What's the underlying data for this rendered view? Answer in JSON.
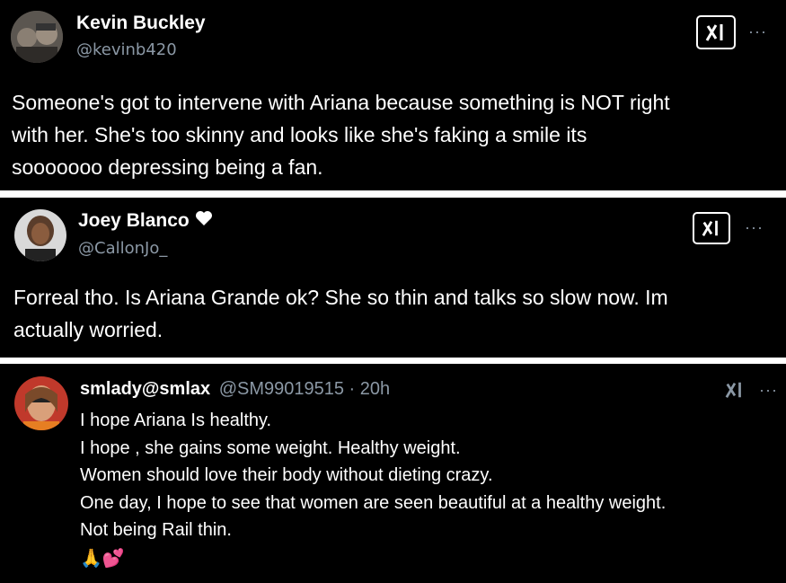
{
  "tweets": [
    {
      "name": "Kevin Buckley",
      "handle": "@kevinb420",
      "lines": [
        "Someone's got to intervene with Ariana because something is NOT right",
        "with her. She's too skinny and looks like she's faking a smile its",
        "sooooooo depressing being a fan."
      ]
    },
    {
      "name": "Joey Blanco",
      "handle": "@CallonJo_",
      "lines": [
        "Forreal tho. Is Ariana Grande ok? She so thin and talks so slow now. Im",
        "actually worried."
      ]
    },
    {
      "name": "smlady@smlax",
      "handle": "@SM99019515 · 20h",
      "lines": [
        "I hope Ariana Is healthy.",
        "I hope , she gains some weight. Healthy weight.",
        "Women should love their body without dieting crazy.",
        "One day, I hope to see that women are seen beautiful at a healthy weight.",
        "Not being Rail thin."
      ],
      "emoji": "🙏💕"
    }
  ],
  "more_label": "···",
  "colors": {
    "background": "#000000",
    "text": "#ffffff",
    "muted": "#8b98a5",
    "separator": "#ffffff"
  },
  "icons": {
    "grok": "grok-icon",
    "more": "more-icon",
    "heart": "white-heart-icon"
  }
}
